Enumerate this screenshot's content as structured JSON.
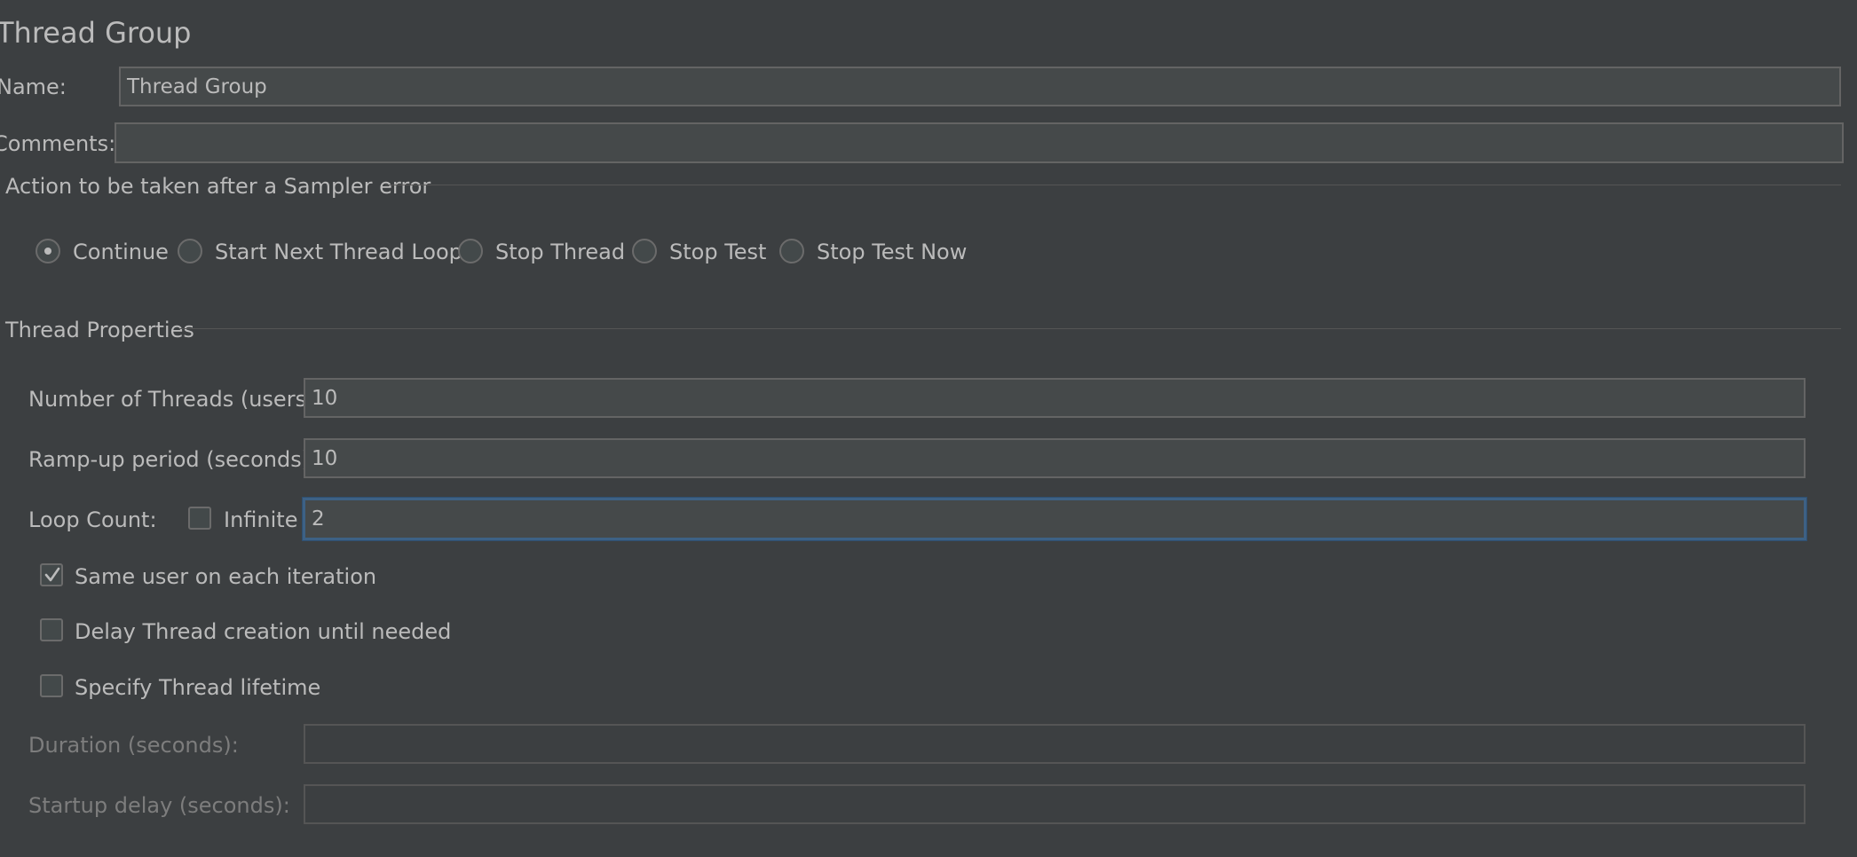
{
  "panel": {
    "title": "Thread Group",
    "name_label": "Name:",
    "name_value": "Thread Group",
    "comments_label": "Comments:",
    "comments_value": ""
  },
  "sampler_error": {
    "legend": "Action to be taken after a Sampler error",
    "options": [
      {
        "label": "Continue",
        "selected": true
      },
      {
        "label": "Start Next Thread Loop",
        "selected": false
      },
      {
        "label": "Stop Thread",
        "selected": false
      },
      {
        "label": "Stop Test",
        "selected": false
      },
      {
        "label": "Stop Test Now",
        "selected": false
      }
    ]
  },
  "thread_properties": {
    "legend": "Thread Properties",
    "num_threads_label": "Number of Threads (users):",
    "num_threads_value": "10",
    "ramp_up_label": "Ramp-up period (seconds):",
    "ramp_up_value": "10",
    "loop_count_label": "Loop Count:",
    "infinite_label": "Infinite",
    "infinite_checked": false,
    "loop_count_value": "2",
    "same_user_label": "Same user on each iteration",
    "same_user_checked": true,
    "delay_creation_label": "Delay Thread creation until needed",
    "delay_creation_checked": false,
    "specify_lifetime_label": "Specify Thread lifetime",
    "specify_lifetime_checked": false,
    "duration_label": "Duration (seconds):",
    "duration_value": "",
    "startup_delay_label": "Startup delay (seconds):",
    "startup_delay_value": ""
  },
  "colors": {
    "background": "#3c3f41",
    "field": "#45494a",
    "focus_border": "#3d6185",
    "text": "#bbbbbb",
    "muted_text": "#7d7d7d"
  }
}
